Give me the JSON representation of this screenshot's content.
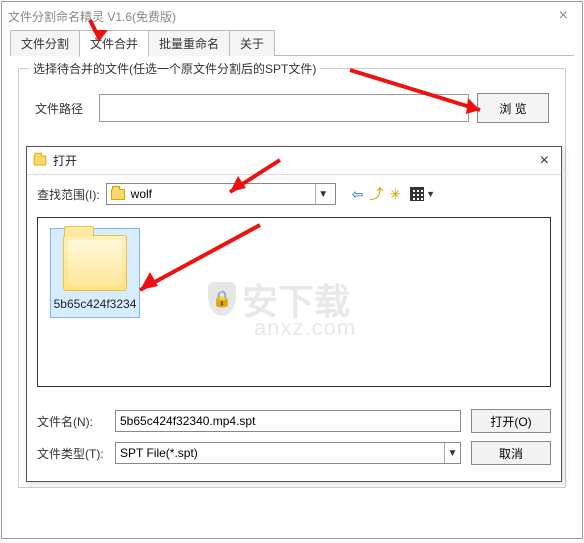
{
  "window": {
    "title": "文件分割命名精灵 V1.6(免费版)"
  },
  "tabs": {
    "split": "文件分割",
    "merge": "文件合并",
    "rename": "批量重命名",
    "about": "关于"
  },
  "groupbox": {
    "title": "选择待合并的文件(任选一个原文件分割后的SPT文件)",
    "path_label": "文件路径",
    "path_value": "",
    "browse": "浏 览"
  },
  "dialog": {
    "title": "打开",
    "lookin_label": "查找范围(I):",
    "lookin_value": "wolf",
    "item_name": "5b65c424f3234",
    "filename_label": "文件名(N):",
    "filename_value": "5b65c424f32340.mp4.spt",
    "filetype_label": "文件类型(T):",
    "filetype_value": "SPT File(*.spt)",
    "open_btn": "打开(O)",
    "cancel_btn": "取消"
  },
  "watermark": {
    "cn": "安下载",
    "en": "anxz.com"
  },
  "icons": {
    "back": "⇦",
    "up": "⤴",
    "newfolder": "✳",
    "lock": "🔒"
  }
}
